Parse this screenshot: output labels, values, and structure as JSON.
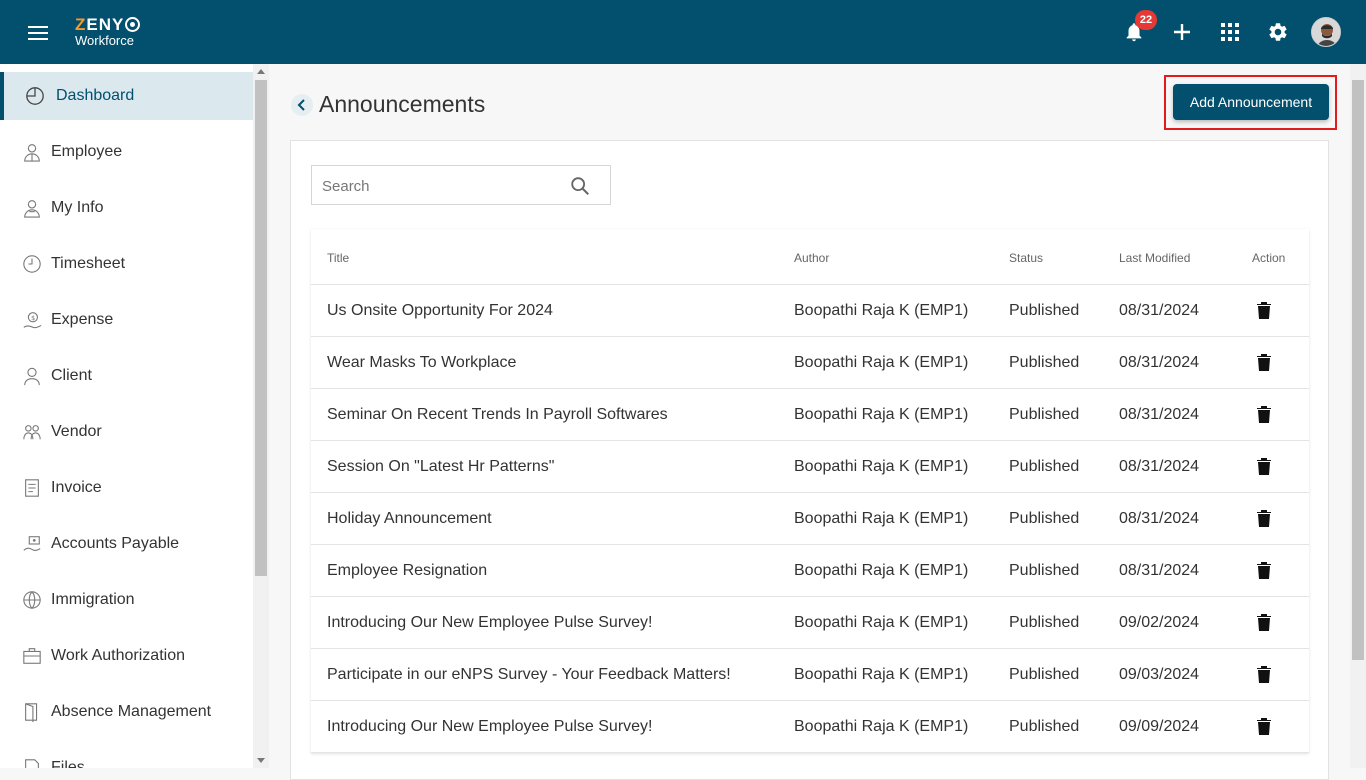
{
  "header": {
    "brand_top": "ZENY",
    "brand_bottom": "Workforce",
    "notification_count": "22"
  },
  "sidebar": {
    "items": [
      {
        "label": "Dashboard",
        "icon": "dashboard-icon",
        "active": true
      },
      {
        "label": "Employee",
        "icon": "employee-icon"
      },
      {
        "label": "My Info",
        "icon": "my-info-icon"
      },
      {
        "label": "Timesheet",
        "icon": "clock-icon"
      },
      {
        "label": "Expense",
        "icon": "expense-icon"
      },
      {
        "label": "Client",
        "icon": "person-icon"
      },
      {
        "label": "Vendor",
        "icon": "vendor-icon"
      },
      {
        "label": "Invoice",
        "icon": "invoice-icon"
      },
      {
        "label": "Accounts Payable",
        "icon": "payable-icon"
      },
      {
        "label": "Immigration",
        "icon": "globe-icon"
      },
      {
        "label": "Work Authorization",
        "icon": "briefcase-icon"
      },
      {
        "label": "Absence Management",
        "icon": "door-icon"
      },
      {
        "label": "Files",
        "icon": "file-icon"
      }
    ]
  },
  "page": {
    "title": "Announcements",
    "add_button": "Add Announcement"
  },
  "search": {
    "placeholder": "Search"
  },
  "table": {
    "columns": [
      "Title",
      "Author",
      "Status",
      "Last Modified",
      "Action"
    ],
    "rows": [
      {
        "title": "Us Onsite Opportunity For 2024",
        "author": "Boopathi Raja K (EMP1)",
        "status": "Published",
        "modified": "08/31/2024"
      },
      {
        "title": "Wear Masks To Workplace",
        "author": "Boopathi Raja K (EMP1)",
        "status": "Published",
        "modified": "08/31/2024"
      },
      {
        "title": "Seminar On Recent Trends In Payroll Softwares",
        "author": "Boopathi Raja K (EMP1)",
        "status": "Published",
        "modified": "08/31/2024"
      },
      {
        "title": "Session On \"Latest Hr Patterns\"",
        "author": "Boopathi Raja K (EMP1)",
        "status": "Published",
        "modified": "08/31/2024"
      },
      {
        "title": "Holiday Announcement",
        "author": "Boopathi Raja K (EMP1)",
        "status": "Published",
        "modified": "08/31/2024"
      },
      {
        "title": "Employee Resignation",
        "author": "Boopathi Raja K (EMP1)",
        "status": "Published",
        "modified": "08/31/2024"
      },
      {
        "title": "Introducing Our New Employee Pulse Survey!",
        "author": "Boopathi Raja K (EMP1)",
        "status": "Published",
        "modified": "09/02/2024"
      },
      {
        "title": "Participate in our eNPS Survey - Your Feedback Matters!",
        "author": "Boopathi Raja K (EMP1)",
        "status": "Published",
        "modified": "09/03/2024"
      },
      {
        "title": "Introducing Our New Employee Pulse Survey!",
        "author": "Boopathi Raja K (EMP1)",
        "status": "Published",
        "modified": "09/09/2024"
      }
    ]
  }
}
